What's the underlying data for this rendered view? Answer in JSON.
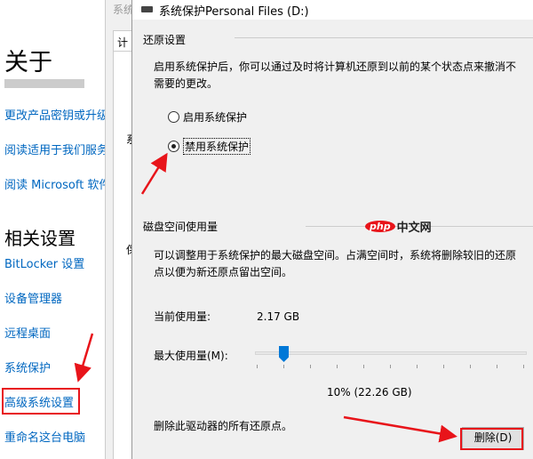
{
  "settings": {
    "about_heading": "关于",
    "links_top": [
      "更改产品密钥或升级",
      "阅读适用于我们服务",
      "阅读 Microsoft 软件"
    ],
    "related_heading": "相关设置",
    "related_links": [
      "BitLocker 设置",
      "设备管理器",
      "远程桌面",
      "系统保护",
      "高级系统设置",
      "重命名这台电脑"
    ]
  },
  "back_dialog": {
    "title": "系统",
    "tab": "计",
    "label1": "系",
    "label2": "保"
  },
  "dialog": {
    "title": "系统保护Personal Files (D:)",
    "restore_group": "还原设置",
    "restore_desc": "启用系统保护后，你可以通过及时将计算机还原到以前的某个状态点来撤消不需要的更改。",
    "radio_enable": "启用系统保护",
    "radio_disable": "禁用系统保护",
    "selected": "disable",
    "disk_group": "磁盘空间使用量",
    "disk_desc": "可以调整用于系统保护的最大磁盘空间。占满空间时，系统将删除较旧的还原点以便为新还原点留出空间。",
    "current_label": "当前使用量:",
    "current_value": "2.17 GB",
    "max_label": "最大使用量(M):",
    "max_percent": 10,
    "max_value": "10% (22.26 GB)",
    "delete_desc": "删除此驱动器的所有还原点。",
    "delete_button": "删除(D)"
  },
  "watermark": {
    "php": "php",
    "cn": "中文网"
  }
}
